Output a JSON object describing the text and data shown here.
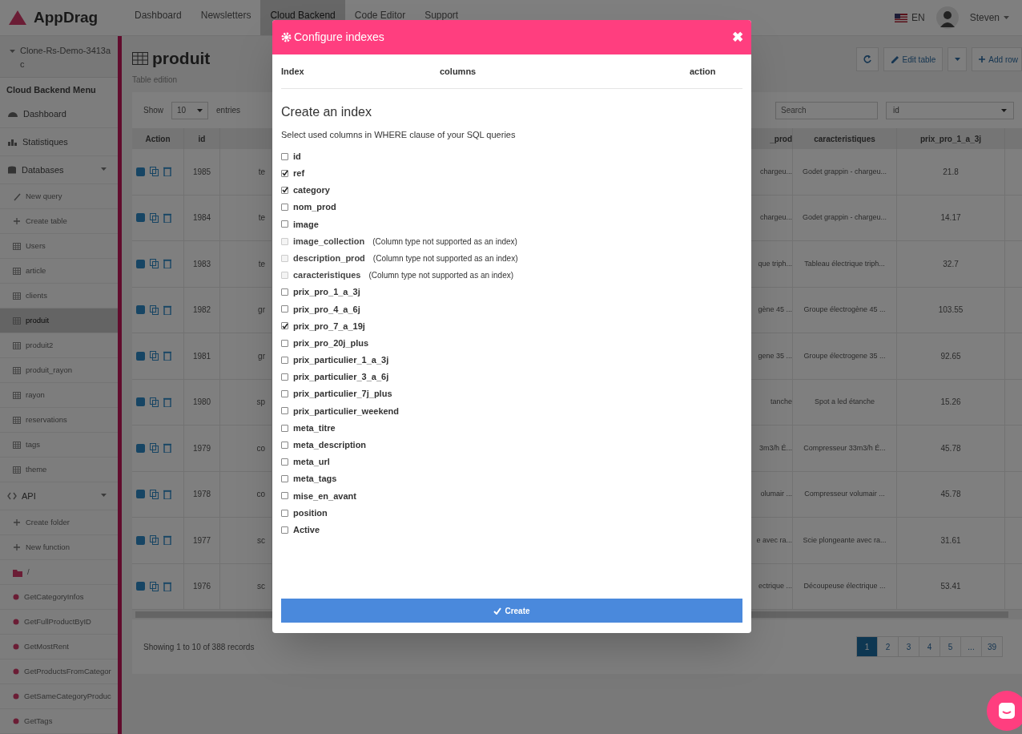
{
  "top_nav": {
    "logo": "AppDrag",
    "items": [
      {
        "label": "Dashboard",
        "selected": false
      },
      {
        "label": "Newsletters",
        "selected": false
      },
      {
        "label": "Cloud Backend",
        "selected": true
      },
      {
        "label": "Code Editor",
        "selected": false
      },
      {
        "label": "Support",
        "selected": false
      }
    ],
    "language": "EN",
    "user": "Steven"
  },
  "sidebar": {
    "project": "Clone-Rs-Demo-3413ac",
    "heading": "Cloud Backend Menu",
    "items": [
      {
        "label": "Dashboard",
        "kind": "dashboard",
        "selected": false
      },
      {
        "label": "Statistiques",
        "kind": "statistics",
        "selected": false
      },
      {
        "label": "Databases",
        "kind": "databases",
        "selected": false,
        "expanded": true
      },
      {
        "label": "New query",
        "kind": "query",
        "selected": false
      },
      {
        "label": "Create table",
        "kind": "create",
        "selected": false
      },
      {
        "label": "Users",
        "kind": "table",
        "selected": false
      },
      {
        "label": "article",
        "kind": "table",
        "selected": false
      },
      {
        "label": "clients",
        "kind": "table",
        "selected": false
      },
      {
        "label": "produit",
        "kind": "table",
        "selected": true
      },
      {
        "label": "produit2",
        "kind": "table",
        "selected": false
      },
      {
        "label": "produit_rayon",
        "kind": "table",
        "selected": false
      },
      {
        "label": "rayon",
        "kind": "table",
        "selected": false
      },
      {
        "label": "reservations",
        "kind": "table",
        "selected": false
      },
      {
        "label": "tags",
        "kind": "table",
        "selected": false
      },
      {
        "label": "theme",
        "kind": "table",
        "selected": false
      },
      {
        "label": "API",
        "kind": "api",
        "selected": false,
        "expanded": true
      },
      {
        "label": "Create folder",
        "kind": "create",
        "selected": false
      },
      {
        "label": "New function",
        "kind": "create",
        "selected": false
      },
      {
        "label": "/",
        "kind": "folder",
        "selected": false
      },
      {
        "label": "GetCategoryInfos",
        "kind": "function",
        "selected": false
      },
      {
        "label": "GetFullProductByID",
        "kind": "function",
        "selected": false
      },
      {
        "label": "GetMostRent",
        "kind": "function",
        "selected": false
      },
      {
        "label": "GetProductsFromCategor",
        "kind": "function",
        "selected": false
      },
      {
        "label": "GetSameCategoryProduc",
        "kind": "function",
        "selected": false
      },
      {
        "label": "GetTags",
        "kind": "function",
        "selected": false
      }
    ]
  },
  "page": {
    "title": "produit",
    "subtitle": "Table edition",
    "buttons": [
      "Edit table",
      "Add row"
    ],
    "show_label": "Show",
    "page_size": "10",
    "entries_label": "entries",
    "search_placeholder": "Search",
    "search_column": "id"
  },
  "table": {
    "columns": [
      "Action",
      "id",
      "_prod",
      "caracteristiques",
      "prix_pro_1_a_3j"
    ],
    "rows": [
      {
        "id": "1985",
        "column_3": "te",
        "column_4": "chargeu...",
        "caracteristiques": "Godet grappin - chargeu...",
        "prix_pro_1_a_3j": "21.8"
      },
      {
        "id": "1984",
        "column_3": "te",
        "column_4": "chargeu...",
        "caracteristiques": "Godet grappin - chargeu...",
        "prix_pro_1_a_3j": "14.17"
      },
      {
        "id": "1983",
        "column_3": "te",
        "column_4": "que triph...",
        "caracteristiques": "Tableau électrique triph...",
        "prix_pro_1_a_3j": "32.7"
      },
      {
        "id": "1982",
        "column_3": "gr",
        "column_4": "gène 45 ...",
        "caracteristiques": "Groupe électrogène 45 ...",
        "prix_pro_1_a_3j": "103.55"
      },
      {
        "id": "1981",
        "column_3": "gr",
        "column_4": "gene 35 ...",
        "caracteristiques": "Groupe électrogene 35 ...",
        "prix_pro_1_a_3j": "92.65"
      },
      {
        "id": "1980",
        "column_3": "sp",
        "column_4": "tanche",
        "caracteristiques": "Spot a led étanche",
        "prix_pro_1_a_3j": "15.26"
      },
      {
        "id": "1979",
        "column_3": "co",
        "column_4": "3m3/h É...",
        "caracteristiques": "Compresseur 33m3/h É...",
        "prix_pro_1_a_3j": "45.78"
      },
      {
        "id": "1978",
        "column_3": "co",
        "column_4": "olumair ...",
        "caracteristiques": "Compresseur volumair ...",
        "prix_pro_1_a_3j": "45.78"
      },
      {
        "id": "1977",
        "column_3": "sc",
        "column_4": "e avec ra...",
        "caracteristiques": "Scie plongeante avec ra...",
        "prix_pro_1_a_3j": "31.61"
      },
      {
        "id": "1976",
        "column_3": "sc",
        "column_4": "ectrique ...",
        "caracteristiques": "Découpeuse électrique ...",
        "prix_pro_1_a_3j": "53.41"
      }
    ],
    "info": "Showing 1 to 10 of 388 records",
    "pages": [
      {
        "label": "1",
        "selected": true
      },
      {
        "label": "2",
        "selected": false
      },
      {
        "label": "3",
        "selected": false
      },
      {
        "label": "4",
        "selected": false
      },
      {
        "label": "5",
        "selected": false
      },
      {
        "label": "...",
        "selected": false
      },
      {
        "label": "39",
        "selected": false
      }
    ]
  },
  "modal": {
    "title": "Configure indexes",
    "close": "✖",
    "columns": [
      "Index",
      "columns",
      "action"
    ],
    "heading": "Create an index",
    "hint": "Select used columns in WHERE clause of your SQL queries",
    "options": [
      {
        "label": "id",
        "checked": false,
        "disabled": false
      },
      {
        "label": "ref",
        "checked": true,
        "disabled": false
      },
      {
        "label": "category",
        "checked": true,
        "disabled": false
      },
      {
        "label": "nom_prod",
        "checked": false,
        "disabled": false
      },
      {
        "label": "image",
        "checked": false,
        "disabled": false
      },
      {
        "label": "image_collection",
        "checked": false,
        "disabled": true,
        "note": "(Column type not supported as an index)"
      },
      {
        "label": "description_prod",
        "checked": false,
        "disabled": true,
        "note": "(Column type not supported as an index)"
      },
      {
        "label": "caracteristiques",
        "checked": false,
        "disabled": true,
        "note": "(Column type not supported as an index)"
      },
      {
        "label": "prix_pro_1_a_3j",
        "checked": false,
        "disabled": false
      },
      {
        "label": "prix_pro_4_a_6j",
        "checked": false,
        "disabled": false
      },
      {
        "label": "prix_pro_7_a_19j",
        "checked": true,
        "disabled": false
      },
      {
        "label": "prix_pro_20j_plus",
        "checked": false,
        "disabled": false
      },
      {
        "label": "prix_particulier_1_a_3j",
        "checked": false,
        "disabled": false
      },
      {
        "label": "prix_particulier_3_a_6j",
        "checked": false,
        "disabled": false
      },
      {
        "label": "prix_particulier_7j_plus",
        "checked": false,
        "disabled": false
      },
      {
        "label": "prix_particulier_weekend",
        "checked": false,
        "disabled": false
      },
      {
        "label": "meta_titre",
        "checked": false,
        "disabled": false
      },
      {
        "label": "meta_description",
        "checked": false,
        "disabled": false
      },
      {
        "label": "meta_url",
        "checked": false,
        "disabled": false
      },
      {
        "label": "meta_tags",
        "checked": false,
        "disabled": false
      },
      {
        "label": "mise_en_avant",
        "checked": false,
        "disabled": false
      },
      {
        "label": "position",
        "checked": false,
        "disabled": false
      },
      {
        "label": "Active",
        "checked": false,
        "disabled": false
      }
    ],
    "submit": "Create"
  }
}
